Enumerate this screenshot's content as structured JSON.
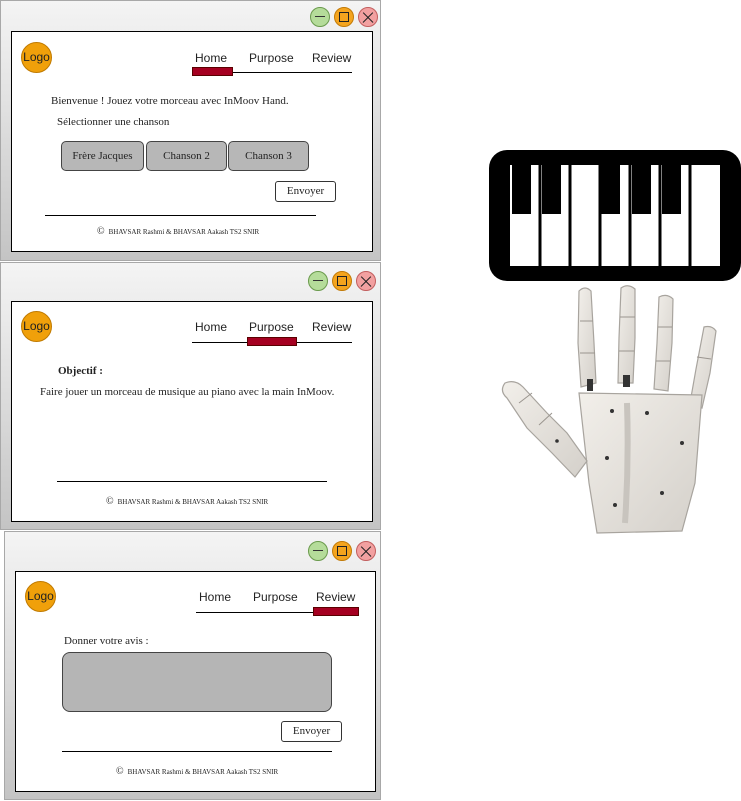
{
  "nav": {
    "home": "Home",
    "purpose": "Purpose",
    "review": "Review"
  },
  "logo": "Logo",
  "home_window": {
    "welcome": "Bienvenue ! Jouez votre morceau avec InMoov Hand.",
    "select_label": "Sélectionner une chanson",
    "songs": [
      "Frère Jacques",
      "Chanson 2",
      "Chanson 3"
    ],
    "send": "Envoyer"
  },
  "purpose_window": {
    "heading": "Objectif :",
    "text": "Faire jouer un morceau de musique au piano avec la main InMoov."
  },
  "review_window": {
    "label": "Donner votre avis :",
    "send": "Envoyer"
  },
  "footer": {
    "copyright_symbol": "©",
    "text": "BHAVSAR Rashmi & BHAVSAR Aakash TS2 SNIR"
  },
  "colors": {
    "active_tab": "#a50021",
    "logo": "#f0a00a",
    "button_gray": "#b7b7b7"
  },
  "illustrations": [
    "piano-keyboard-icon",
    "robotic-hand-image"
  ]
}
